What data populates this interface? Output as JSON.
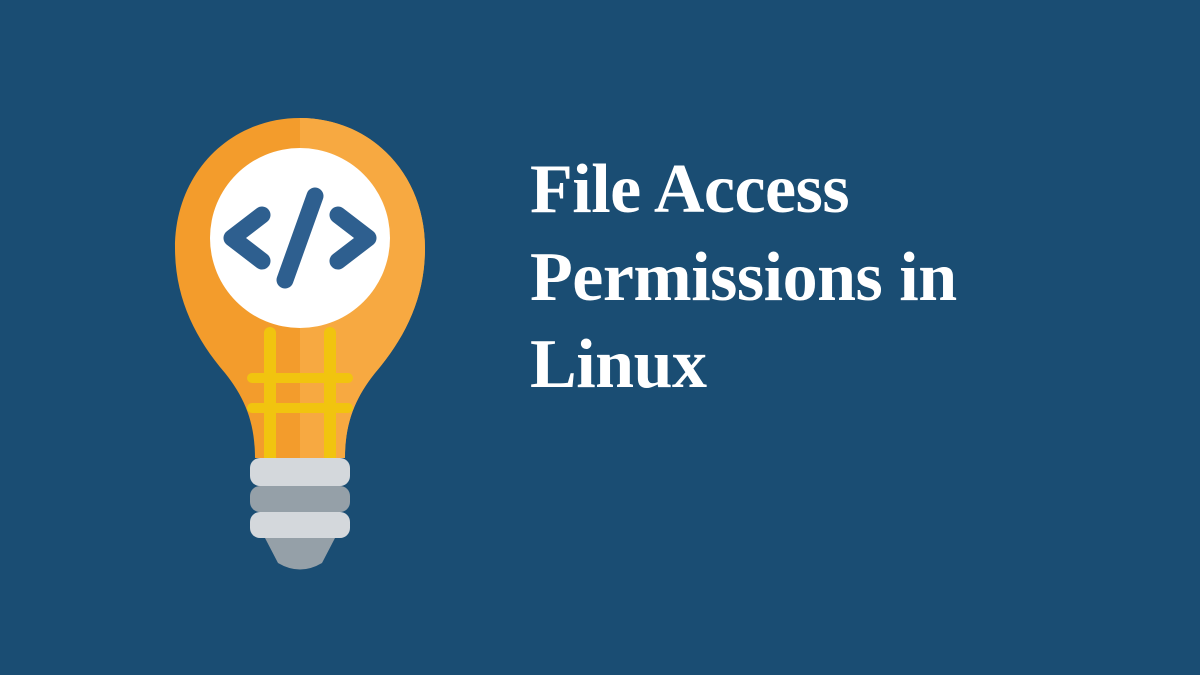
{
  "title": "File Access Permissions in Linux",
  "colors": {
    "background": "#1a4d73",
    "bulb_orange": "#f39c2c",
    "bulb_orange_light": "#f7a941",
    "filament_yellow": "#f1c40f",
    "circle_white": "#ffffff",
    "code_blue": "#2e5f8f",
    "socket_light": "#d4d8dc",
    "socket_dark": "#95a0a8",
    "text": "#ffffff"
  },
  "icon_name": "lightbulb-code-icon"
}
